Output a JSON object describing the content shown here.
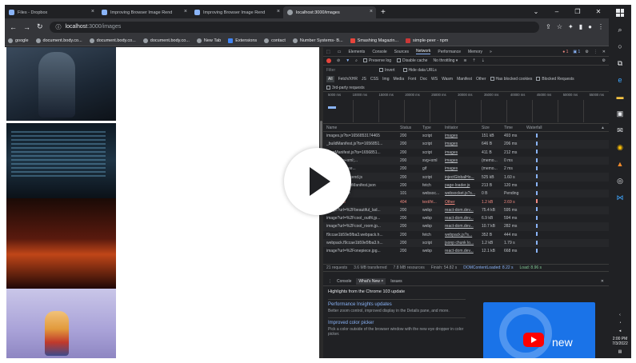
{
  "browser": {
    "tabs": [
      {
        "title": "Files - Dropbox",
        "active": false
      },
      {
        "title": "Improving Browser Image Rend",
        "active": false
      },
      {
        "title": "Improving Browser Image Rend",
        "active": false
      },
      {
        "title": "localhost:3000/images",
        "active": true
      }
    ],
    "address": {
      "host": "localhost",
      "path": ":3000/images"
    },
    "bookmarks": [
      "google",
      "document.body.co...",
      "document.body.co...",
      "document.body.co...",
      "New Tab",
      "Extensions",
      "contact",
      "Number Systems- B...",
      "Smashing Magazin...",
      "simple-peer - npm"
    ]
  },
  "devtools": {
    "tabs": [
      "Elements",
      "Console",
      "Sources",
      "Network",
      "Performance",
      "Memory"
    ],
    "active_tab": "Network",
    "badges": {
      "errors": "1",
      "warnings": "1"
    },
    "toolbar": {
      "preserve_log": "Preserve log",
      "disable_cache": "Disable cache",
      "throttling": "No throttling"
    },
    "filter": {
      "placeholder": "Filter",
      "invert": "Invert",
      "hide_data_urls": "Hide data URLs"
    },
    "types": [
      "All",
      "Fetch/XHR",
      "JS",
      "CSS",
      "Img",
      "Media",
      "Font",
      "Doc",
      "WS",
      "Wasm",
      "Manifest",
      "Other"
    ],
    "blocked_cookies": "Has blocked cookies",
    "blocked_requests": "Blocked Requests",
    "third_party": "3rd-party requests",
    "timeline_ticks": [
      "5000 ms",
      "10000 ms",
      "15000 ms",
      "20000 ms",
      "25000 ms",
      "30000 ms",
      "35000 ms",
      "40000 ms",
      "45000 ms",
      "50000 ms",
      "55000 ms"
    ],
    "columns": {
      "name": "Name",
      "status": "Status",
      "type": "Type",
      "initiator": "Initiator",
      "size": "Size",
      "time": "Time",
      "waterfall": "Waterfall"
    },
    "requests": [
      {
        "name": "images.js?ts=1656853174465",
        "status": "200",
        "type": "script",
        "initiator": "images",
        "size": "151 kB",
        "time": "493 ms"
      },
      {
        "name": "_buildManifest.js?ts=1656851...",
        "status": "200",
        "type": "script",
        "initiator": "images",
        "size": "646 B",
        "time": "206 ms"
      },
      {
        "name": "_ssgManifest.js?ts=1656851...",
        "status": "200",
        "type": "script",
        "initiator": "images",
        "size": "411 B",
        "time": "212 ms"
      },
      {
        "name": "image/svg+xml;...",
        "status": "200",
        "type": "svg+xml",
        "initiator": "images",
        "size": "(memo...",
        "time": "0 ms"
      },
      {
        "name": "image/gif;base...",
        "status": "200",
        "type": "gif",
        "initiator": "images",
        "size": "(memo...",
        "time": "2 ms"
      },
      {
        "name": "webpack.backend.js",
        "status": "200",
        "type": "script",
        "initiator": "injectGlobalHo...",
        "size": "525 kB",
        "time": "1.60 s"
      },
      {
        "name": "_buildManifestManifest.json",
        "status": "200",
        "type": "fetch",
        "initiator": "page-loader.js",
        "size": "213 B",
        "time": "120 ms"
      },
      {
        "name": "webpack-hmr",
        "status": "101",
        "type": "websoc...",
        "initiator": "websocket.js?s...",
        "size": "0 B",
        "time": "Pending"
      },
      {
        "name": "favicon.ico",
        "status": "404",
        "type": "text/ht...",
        "initiator": "Other",
        "size": "1.2 kB",
        "time": "2.69 s",
        "error": true
      },
      {
        "name": "image?url=%2Fbeautiful_lad...",
        "status": "200",
        "type": "webp",
        "initiator": "react-dom.dev...",
        "size": "75.4 kB",
        "time": "595 ms"
      },
      {
        "name": "image?url=%2Fcool_outfit.jp...",
        "status": "200",
        "type": "webp",
        "initiator": "react-dom.dev...",
        "size": "6.9 kB",
        "time": "594 ms"
      },
      {
        "name": "image?url=%2Fcool_room.jp...",
        "status": "200",
        "type": "webp",
        "initiator": "react-dom.dev...",
        "size": "10.7 kB",
        "time": "282 ms"
      },
      {
        "name": "f9ccae1b59e5fba3.webpack.h...",
        "status": "200",
        "type": "fetch",
        "initiator": "webpack.js?s...",
        "size": "352 B",
        "time": "444 ms"
      },
      {
        "name": "webpack.f9ccae1b59e5fba3.h...",
        "status": "200",
        "type": "script",
        "initiator": "jsonp chunk lo...",
        "size": "1.2 kB",
        "time": "1.79 s"
      },
      {
        "name": "image?url=%2Fonepiece.jpg...",
        "status": "200",
        "type": "webp",
        "initiator": "react-dom.dev...",
        "size": "12.1 kB",
        "time": "668 ms"
      }
    ],
    "summary": {
      "requests": "21 requests",
      "transferred": "3.6 MB transferred",
      "resources": "7.8 MB resources",
      "finish": "Finish: 54.82 s",
      "dcl": "DOMContentLoaded: 8.22 s",
      "load": "Load: 8.96 s"
    },
    "drawer": {
      "tabs": [
        "Console",
        "What's New",
        "Issues"
      ],
      "active_tab": "What's New",
      "headline": "Highlights from the Chrome 103 update",
      "cards": [
        {
          "title": "Performance Insights updates",
          "text": "Better zoom control, improved display in the Details pane, and more."
        },
        {
          "title": "Improved color picker",
          "text": "Pick a color outside of the browser window with the new eye dropper in color picker."
        }
      ],
      "promo_text": "new"
    }
  },
  "taskbar": {
    "time": "2:00 PM",
    "date": "7/3/2022"
  }
}
